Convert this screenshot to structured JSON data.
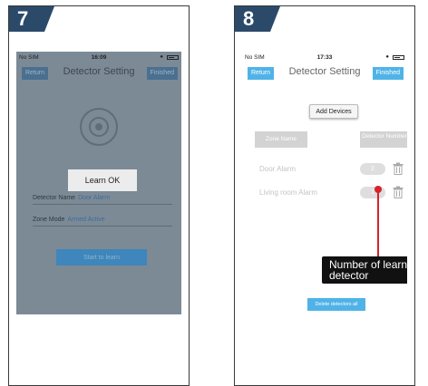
{
  "steps": [
    {
      "number": "7",
      "status_bar": {
        "carrier": "No SIM",
        "time": "16:09"
      },
      "nav": {
        "left_button": "Return",
        "title": "Detector Setting",
        "right_button": "Finished"
      },
      "dialog": {
        "text": "Learn OK"
      },
      "fields": [
        {
          "label": "Detector Name",
          "value": "Door Alarm"
        },
        {
          "label": "Zone Mode",
          "value": "Armed Active"
        }
      ],
      "start_button": "Start to learn"
    },
    {
      "number": "8",
      "status_bar": {
        "carrier": "No SIM",
        "time": "17:33"
      },
      "nav": {
        "left_button": "Return",
        "title": "Detector Setting",
        "right_button": "Finished"
      },
      "add_button": "Add Devices",
      "columns": {
        "zone": "Zone Name",
        "detector": "Detector Number"
      },
      "rows": [
        {
          "name": "Door Alarm",
          "count": "2"
        },
        {
          "name": "Living room Alarm",
          "count": "1"
        }
      ],
      "callout": "Number of learnt detector",
      "delete_button": "Delete detectors all"
    }
  ],
  "colors": {
    "accent": "#4fb3e8",
    "badge": "#2b4a6a",
    "callout_line": "#d8232a"
  },
  "icons": [
    "wifi-icon",
    "lock-icon",
    "battery-icon",
    "detector-icon",
    "trash-icon"
  ]
}
